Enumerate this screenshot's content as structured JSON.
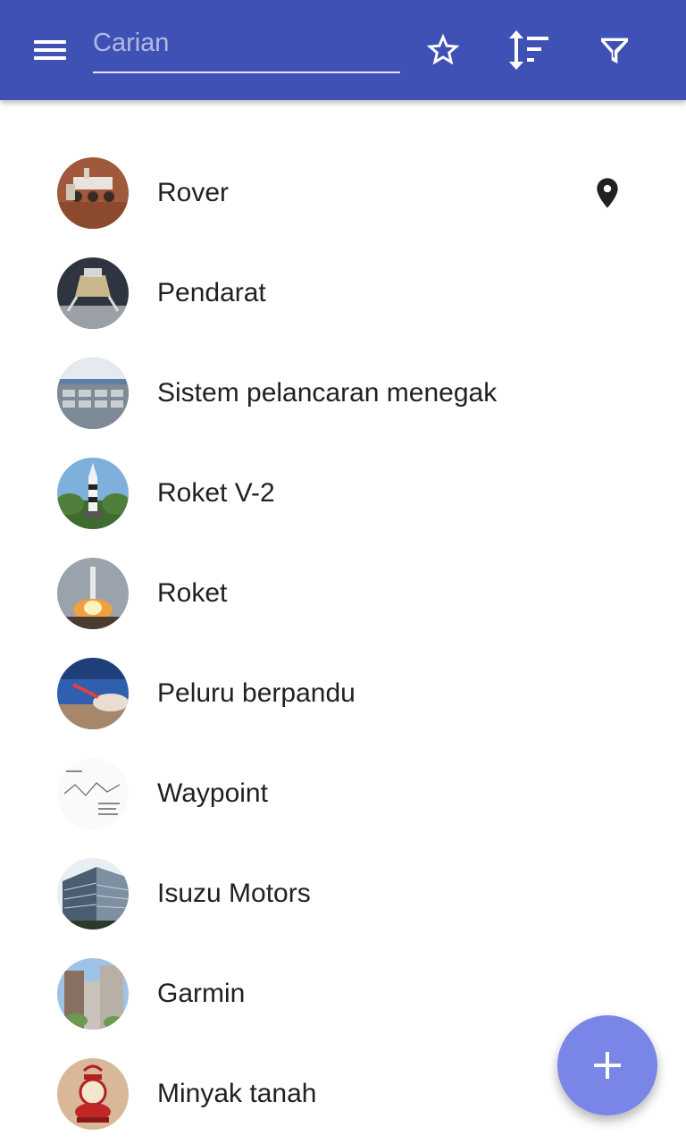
{
  "toolbar": {
    "search_placeholder": "Carian",
    "menu_icon": "menu-icon",
    "favorite_icon": "star-outline-icon",
    "sort_icon": "sort-icon",
    "filter_icon": "filter-icon",
    "background_color": "#3f51b5"
  },
  "items": [
    {
      "label": "Rover",
      "thumbnail": "rover-photo",
      "has_location": true
    },
    {
      "label": "Pendarat",
      "thumbnail": "lunar-lander-photo"
    },
    {
      "label": "Sistem pelancaran menegak",
      "thumbnail": "launch-system-photo"
    },
    {
      "label": "Roket V-2",
      "thumbnail": "v2-rocket-photo"
    },
    {
      "label": "Roket",
      "thumbnail": "rocket-launch-photo"
    },
    {
      "label": "Peluru berpandu",
      "thumbnail": "missile-photo"
    },
    {
      "label": "Waypoint",
      "thumbnail": "waypoint-diagram"
    },
    {
      "label": "Isuzu Motors",
      "thumbnail": "office-building-photo"
    },
    {
      "label": "Garmin",
      "thumbnail": "city-buildings-photo"
    },
    {
      "label": "Minyak tanah",
      "thumbnail": "kerosene-lamp-photo"
    }
  ],
  "fab": {
    "icon": "add-icon",
    "color": "#7986e8"
  }
}
